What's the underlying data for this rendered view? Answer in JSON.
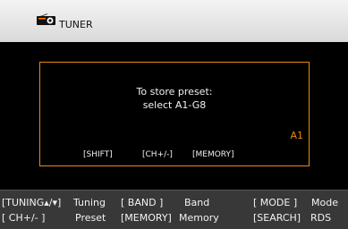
{
  "header": {
    "title": "TUNER",
    "icon": "radio-icon"
  },
  "dialog": {
    "line1": "To store preset:",
    "line2": "select A1-G8",
    "preset": "A1",
    "shift_key": "[SHIFT]",
    "ch_key": "[CH+/-]",
    "memory_key": "[MEMORY]"
  },
  "footer": {
    "row1": {
      "tuning_key": "[TUNING▴/▾]",
      "tuning_label": "Tuning",
      "band_key": "[ BAND ]",
      "band_label": "Band",
      "mode_key": "[ MODE ]",
      "mode_label": "Mode"
    },
    "row2": {
      "ch_key": "[ CH+/- ]",
      "preset_label": "Preset",
      "memory_key": "[MEMORY]",
      "memory_label": "Memory",
      "search_key": "[SEARCH]",
      "rds_label": "RDS"
    }
  },
  "colors": {
    "accent": "#e68a16",
    "background": "#000000",
    "header": "#e6e6e6",
    "footer": "#383838",
    "text": "#f2f2f2"
  }
}
